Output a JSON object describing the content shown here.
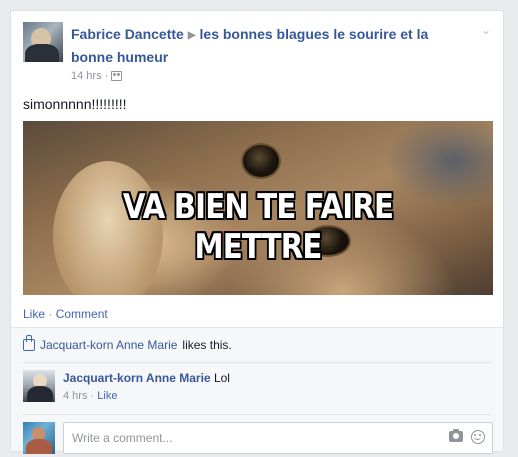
{
  "post": {
    "author": "Fabrice Dancette",
    "group": "les bonnes blagues le sourire et la bonne humeur",
    "time": "14 hrs",
    "meta_separator": "·",
    "text": "simonnnnn!!!!!!!!!",
    "image_caption": "VA BIEN TE FAIRE METTRE"
  },
  "actions": {
    "like": "Like",
    "separator": "·",
    "comment": "Comment"
  },
  "likes": {
    "name": "Jacquart-korn Anne Marie",
    "suffix": "likes this."
  },
  "comments": [
    {
      "author": "Jacquart-korn Anne Marie",
      "text": "Lol",
      "time": "4 hrs",
      "separator": "·",
      "like": "Like"
    }
  ],
  "composer": {
    "placeholder": "Write a comment..."
  },
  "icons": {
    "arrow": "▶",
    "chevron": "⌄"
  },
  "colors": {
    "link": "#365899",
    "action": "#4267b2",
    "muted": "#90949c",
    "background": "#e9ebee"
  }
}
